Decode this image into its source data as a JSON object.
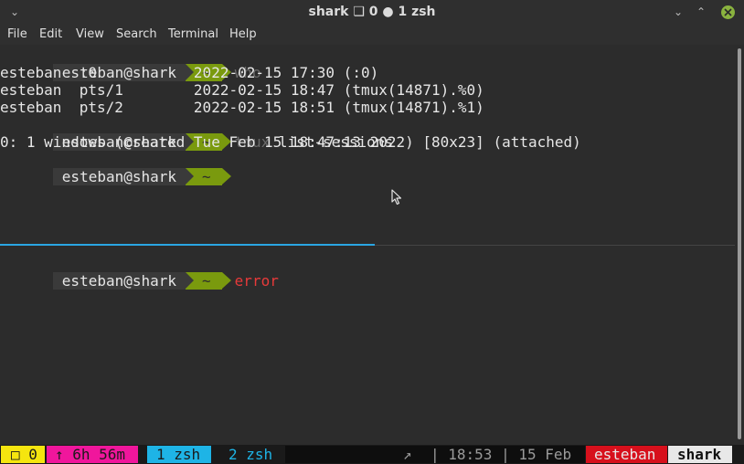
{
  "window": {
    "title": "shark ❑ 0 ● 1 zsh",
    "menu_icon": "⌄",
    "minimize_icon": "⌄",
    "maximize_icon": "⌃"
  },
  "menubar": {
    "items": [
      "File",
      "Edit",
      "View",
      "Search",
      "Terminal",
      "Help"
    ]
  },
  "prompt": {
    "user_host": "esteban@shark",
    "dir": "~"
  },
  "terminal": {
    "top_pane": [
      {
        "type": "prompt",
        "cmd": "who",
        "cmd_style": "dim"
      },
      {
        "type": "output",
        "text": "esteban  :0           2022-02-15 17:30 (:0)"
      },
      {
        "type": "output",
        "text": "esteban  pts/1        2022-02-15 18:47 (tmux(14871).%0)"
      },
      {
        "type": "output",
        "text": "esteban  pts/2        2022-02-15 18:51 (tmux(14871).%1)"
      },
      {
        "type": "prompt",
        "cmd_prefix": "tmux",
        "cmd": "list-sessions"
      },
      {
        "type": "output",
        "text": "0: 1 windows (created Tue Feb 15 18:47:13 2022) [80x23] (attached)"
      },
      {
        "type": "prompt",
        "cmd": ""
      }
    ],
    "bottom_pane": [
      {
        "type": "prompt",
        "cmd": "error",
        "cmd_style": "error"
      }
    ]
  },
  "statusbar": {
    "session": "□ 0",
    "uptime": "↑ 6h 56m",
    "window_active": "1 zsh",
    "window_inactive": "2 zsh",
    "arrow": "↗",
    "time": "| 18:53 | 15 Feb",
    "user": "esteban",
    "host": "shark"
  },
  "colors": {
    "accent_blue": "#2aa6e3",
    "prompt_green": "#7a9a0e",
    "session_yellow": "#f5e50f",
    "uptime_magenta": "#f0169c",
    "window_cyan": "#1eb4e6",
    "user_red": "#d7101c",
    "host_white": "#e8e8e8"
  }
}
